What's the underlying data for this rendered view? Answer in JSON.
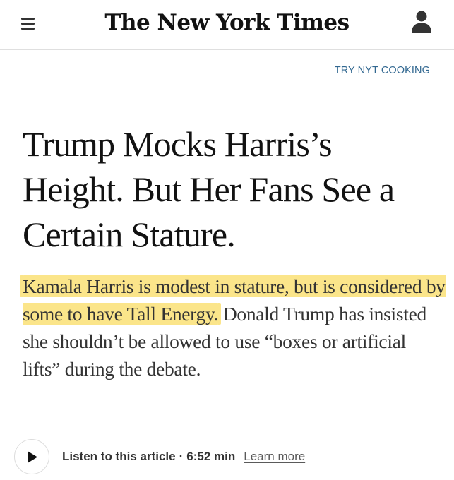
{
  "header": {
    "logo_text": "The New York Times",
    "menu_icon": "hamburger-menu-icon",
    "account_icon": "user-account-icon"
  },
  "promo": {
    "label": "TRY NYT COOKING",
    "color": "#326891"
  },
  "article": {
    "headline": "Trump Mocks Harris’s Height. But Her Fans See a Certain Stature.",
    "summary_highlighted": "Kamala Harris is modest in stature, but is considered by some to have Tall Energy.",
    "summary_rest": "Donald Trump has insisted she shouldn’t be allowed to use “boxes or artificial lifts” during the debate.",
    "highlight_color": "#fbe58a"
  },
  "audio": {
    "play_icon": "play-icon",
    "listen_label": "Listen to this article",
    "separator": "·",
    "duration": "6:52 min",
    "learn_more": "Learn more"
  }
}
